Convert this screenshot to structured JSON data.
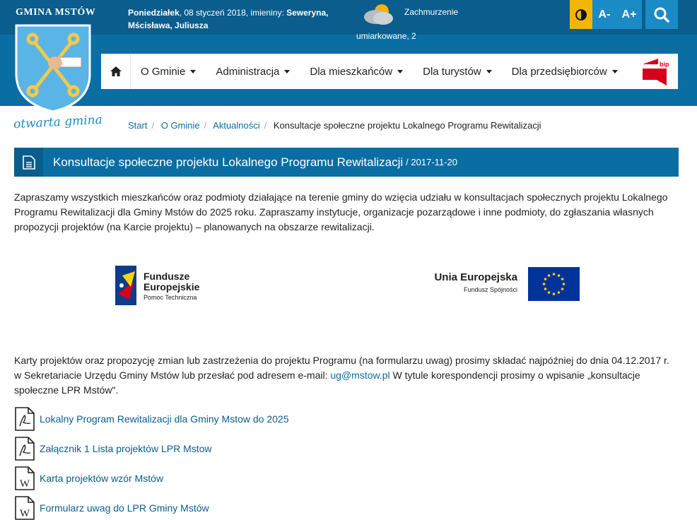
{
  "header": {
    "site_name": "GMINA MSTÓW",
    "motto": "otwarta gmina",
    "date_day": "Poniedziałek",
    "date_rest": ", 08 styczeń 2018, imieniny: ",
    "names": "Seweryna, Mścisława, Juliusza",
    "weather_line1": "Zachmurzenie",
    "weather_line2": "umiarkowane, 2",
    "tools": {
      "contrast_icon": "contrast-icon",
      "font_decrease": "A-",
      "font_increase": "A+",
      "search_icon": "search-icon"
    }
  },
  "nav": {
    "home_icon": "home-icon",
    "items": [
      {
        "label": "O Gminie"
      },
      {
        "label": "Administracja"
      },
      {
        "label": "Dla mieszkańców"
      },
      {
        "label": "Dla turystów"
      },
      {
        "label": "Dla przedsiębiorców"
      }
    ],
    "bip_label": "bip"
  },
  "breadcrumb": {
    "items": [
      "Start",
      "O Gminie",
      "Aktualności"
    ],
    "current": "Konsultacje społeczne projektu Lokalnego Programu Rewitalizacji"
  },
  "article": {
    "title": "Konsultacje społeczne projektu Lokalnego Programu Rewitalizacji",
    "date": "/ 2017-11-20",
    "paragraph1": "Zapraszamy wszystkich mieszkańców oraz podmioty działające na terenie gminy do wzięcia udziału w konsultacjach społecznych projektu Lokalnego Programu Rewitalizacji dla Gminy Mstów do 2025 roku. Zapraszamy instytucje, organizacje pozarządowe i inne podmioty, do zgłaszania własnych propozycji projektów (na Karcie projektu) – planowanych na obszarze rewitalizacji.",
    "paragraph2_before": "Karty projektów oraz propozycję zmian lub zastrzeżenia do projektu Programu (na formularzu uwag) prosimy składać najpóźniej do dnia 04.12.2017 r. w Sekretariacie Urzędu Gminy Mstów lub przesłać pod adresem e-mail: ",
    "email": "ug@mstow.pl",
    "paragraph2_after": " W tytule korespondencji prosimy o wpisanie „konsultacje społeczne LPR Mstów\".",
    "logos": {
      "fe_line1": "Fundusze",
      "fe_line2": "Europejskie",
      "fe_sub": "Pomoc Techniczna",
      "ue_title": "Unia Europejska",
      "ue_sub": "Fundusz Spójności"
    },
    "attachments": [
      {
        "type": "pdf",
        "label": "Lokalny Program Rewitalizacji dla Gminy Mstow do 2025"
      },
      {
        "type": "pdf",
        "label": "Załącznik 1 Lista projektów LPR Mstow"
      },
      {
        "type": "word",
        "label": "Karta projektów wzór Mstów"
      },
      {
        "type": "word",
        "label": "Formularz uwag do LPR Gminy Mstów"
      }
    ]
  },
  "colors": {
    "primary": "#0a6ea3",
    "dark": "#0a5d8c",
    "accent_yellow": "#f2b705",
    "tool_blue": "#1b8bc6"
  }
}
